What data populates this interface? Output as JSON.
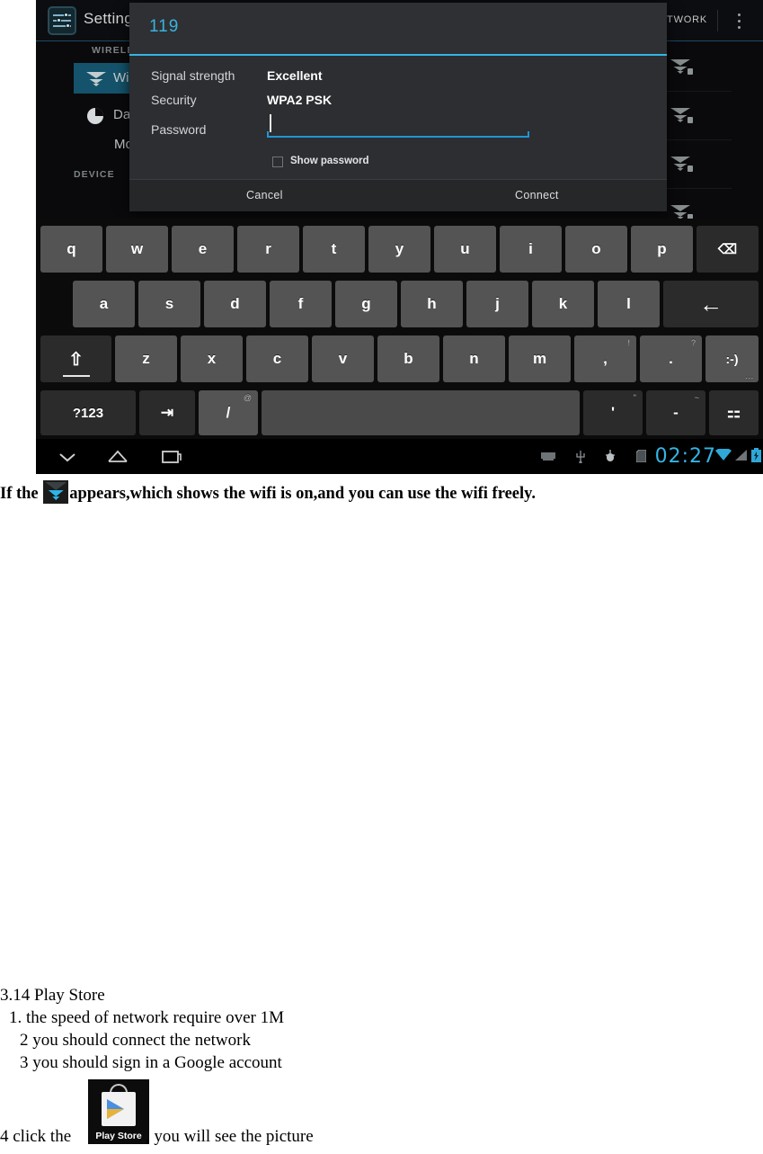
{
  "screenshot": {
    "app": {
      "title": "Settings",
      "icon": "settings-sliders-icon",
      "action_add_network": "D NETWORK",
      "overflow": "overflow-menu-icon"
    },
    "sidebar": {
      "section_wireless": "WIRELESS &",
      "section_device": "DEVICE",
      "items": [
        {
          "label": "Wi-F",
          "icon": "wifi-icon",
          "selected": true
        },
        {
          "label": "Data",
          "icon": "data-usage-icon",
          "selected": false
        },
        {
          "label": "More",
          "icon": "",
          "selected": false
        }
      ]
    },
    "dialog": {
      "title": "119",
      "rows": [
        {
          "label": "Signal strength",
          "value": "Excellent"
        },
        {
          "label": "Security",
          "value": "WPA2 PSK"
        }
      ],
      "password_label": "Password",
      "password_value": "",
      "show_password_label": "Show password",
      "show_password_checked": false,
      "cancel_label": "Cancel",
      "connect_label": "Connect",
      "accent_color": "#33b5e5"
    },
    "keyboard": {
      "row1": [
        {
          "key": "q"
        },
        {
          "key": "w"
        },
        {
          "key": "e"
        },
        {
          "key": "r"
        },
        {
          "key": "t"
        },
        {
          "key": "y"
        },
        {
          "key": "u"
        },
        {
          "key": "i"
        },
        {
          "key": "o"
        },
        {
          "key": "p"
        }
      ],
      "row1_extra": {
        "name": "backspace-key",
        "glyph": "⌫"
      },
      "row2": [
        {
          "key": "a"
        },
        {
          "key": "s"
        },
        {
          "key": "d"
        },
        {
          "key": "f"
        },
        {
          "key": "g"
        },
        {
          "key": "h"
        },
        {
          "key": "j"
        },
        {
          "key": "k"
        },
        {
          "key": "l"
        }
      ],
      "row2_extra": {
        "name": "enter-key",
        "glyph": "←"
      },
      "row3_shift": {
        "name": "shift-key",
        "glyph": "⇧"
      },
      "row3": [
        {
          "key": "z"
        },
        {
          "key": "x"
        },
        {
          "key": "c"
        },
        {
          "key": "v"
        },
        {
          "key": "b"
        },
        {
          "key": "n"
        },
        {
          "key": "m"
        },
        {
          "key": ",",
          "sup": "!"
        },
        {
          "key": ".",
          "sup": "?"
        }
      ],
      "row3_emoji": {
        "key": ":-)",
        "display": ":-)"
      },
      "row4_symbols": "?123",
      "row4_tab": {
        "name": "tab-key",
        "glyph": "⇥"
      },
      "row4_slash": {
        "key": "/",
        "sup": "@"
      },
      "row4_space": "",
      "row4_apos": {
        "key": "'",
        "sup": "\""
      },
      "row4_dash": {
        "key": "-",
        "sup": "~"
      },
      "row4_settings": {
        "name": "keyboard-settings-key",
        "glyph": "⚏"
      }
    },
    "navbar": {
      "back": "hide-keyboard-icon",
      "home": "home-icon",
      "recents": "recents-icon",
      "clock": "02:27",
      "status_icons": [
        "keyboard-icon",
        "usb-icon",
        "usb-debug-icon",
        "sd-card-icon",
        "wifi-icon",
        "signal-icon",
        "battery-charging-icon"
      ]
    }
  },
  "document": {
    "caption_before": "If the",
    "caption_icon": "wifi-status-icon",
    "caption_after": "appears,which shows the wifi is on,and you can use the wifi freely.",
    "section_title": "3.14 Play Store",
    "steps": [
      "1. the speed of network require over 1M",
      "2 you should connect the network",
      "3 you should sign in a Google account"
    ],
    "final_before": "4 click the",
    "play_store_icon_label": "Play Store",
    "final_after": ", you will see the picture"
  }
}
